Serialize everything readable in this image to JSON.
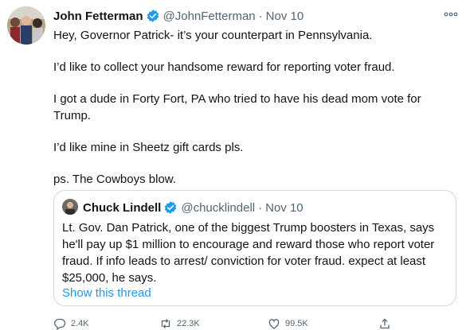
{
  "tweet": {
    "author_name": "John Fetterman",
    "author_handle": "@JohnFetterman",
    "separator": "·",
    "timestamp": "Nov 10",
    "paragraphs": [
      "Hey, Governor Patrick- it’s your counterpart in Pennsylvania.",
      "I’d like to collect your handsome reward for reporting voter fraud.",
      "I got a dude in Forty Fort, PA who tried to have his dead mom vote for Trump.",
      "I’d like mine in Sheetz gift cards pls.",
      "ps.  The Cowboys blow."
    ]
  },
  "quoted_tweet": {
    "author_name": "Chuck Lindell",
    "author_handle": "@chucklindell",
    "separator": "·",
    "timestamp": "Nov 10",
    "text": "Lt. Gov. Dan Patrick, one of the biggest Trump boosters in Texas, says he'll pay up $1 million to encourage and reward those who report voter fraud. If info leads to arrest/ conviction for voter fraud. expect at least $25,000, he says.",
    "show_thread_label": "Show this thread"
  },
  "actions": {
    "reply_count": "2.4K",
    "retweet_count": "22.3K",
    "like_count": "99.5K"
  },
  "icons": {
    "verified": "verified-badge-icon",
    "more": "more-options-icon",
    "reply": "reply-icon",
    "retweet": "retweet-icon",
    "like": "like-icon",
    "share": "share-icon"
  },
  "colors": {
    "accent": "#1d9bf0",
    "secondary_text": "#536471",
    "border": "#cfd9de"
  }
}
